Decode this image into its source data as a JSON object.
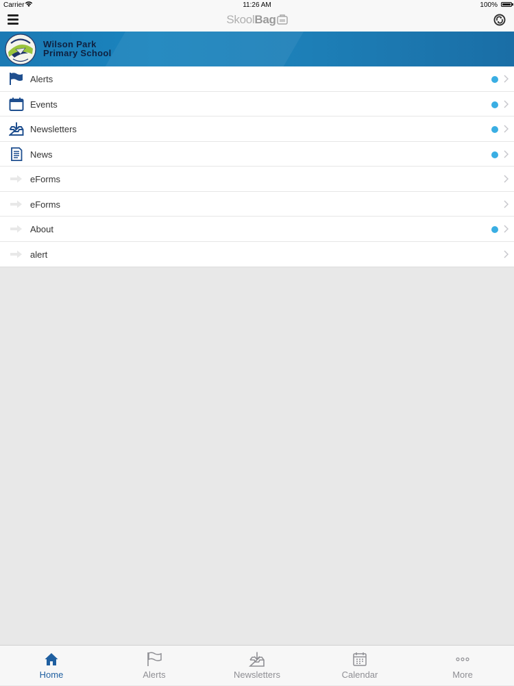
{
  "status": {
    "carrier": "Carrier",
    "time": "11:26 AM",
    "battery": "100%"
  },
  "app": {
    "brand_light": "Skool",
    "brand_bold": "Bag"
  },
  "school": {
    "name_line1": "Wilson Park",
    "name_line2": "Primary School"
  },
  "menu": [
    {
      "label": "Alerts",
      "icon": "flag-icon",
      "badge": true
    },
    {
      "label": "Events",
      "icon": "calendar-icon",
      "badge": true
    },
    {
      "label": "Newsletters",
      "icon": "inbox-download-icon",
      "badge": true
    },
    {
      "label": "News",
      "icon": "document-icon",
      "badge": true
    },
    {
      "label": "eForms",
      "icon": "arrow-right-icon",
      "badge": false
    },
    {
      "label": "eForms",
      "icon": "arrow-right-icon",
      "badge": false
    },
    {
      "label": "About",
      "icon": "arrow-right-icon",
      "badge": true
    },
    {
      "label": "alert",
      "icon": "arrow-right-icon",
      "badge": false
    }
  ],
  "tabs": [
    {
      "label": "Home",
      "icon": "home-icon",
      "active": true
    },
    {
      "label": "Alerts",
      "icon": "flag-icon",
      "active": false
    },
    {
      "label": "Newsletters",
      "icon": "inbox-download-icon",
      "active": false
    },
    {
      "label": "Calendar",
      "icon": "calendar-icon",
      "active": false
    },
    {
      "label": "More",
      "icon": "more-dots-icon",
      "active": false
    }
  ],
  "colors": {
    "accent": "#1f5fa0",
    "badge": "#3aaee3",
    "banner": "#1a84be"
  }
}
